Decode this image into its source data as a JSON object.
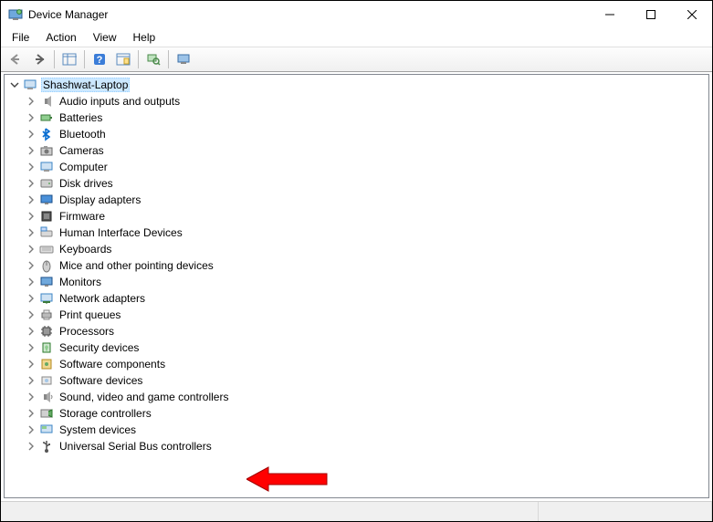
{
  "window": {
    "title": "Device Manager"
  },
  "menu": {
    "items": [
      "File",
      "Action",
      "View",
      "Help"
    ]
  },
  "tree": {
    "root": "Shashwat-Laptop",
    "children": [
      {
        "label": "Audio inputs and outputs",
        "icon": "audio"
      },
      {
        "label": "Batteries",
        "icon": "battery"
      },
      {
        "label": "Bluetooth",
        "icon": "bluetooth"
      },
      {
        "label": "Cameras",
        "icon": "camera"
      },
      {
        "label": "Computer",
        "icon": "computer"
      },
      {
        "label": "Disk drives",
        "icon": "disk"
      },
      {
        "label": "Display adapters",
        "icon": "display"
      },
      {
        "label": "Firmware",
        "icon": "firmware"
      },
      {
        "label": "Human Interface Devices",
        "icon": "hid"
      },
      {
        "label": "Keyboards",
        "icon": "keyboard"
      },
      {
        "label": "Mice and other pointing devices",
        "icon": "mouse"
      },
      {
        "label": "Monitors",
        "icon": "monitor"
      },
      {
        "label": "Network adapters",
        "icon": "network"
      },
      {
        "label": "Print queues",
        "icon": "printer"
      },
      {
        "label": "Processors",
        "icon": "cpu"
      },
      {
        "label": "Security devices",
        "icon": "security"
      },
      {
        "label": "Software components",
        "icon": "swcomp"
      },
      {
        "label": "Software devices",
        "icon": "swdev"
      },
      {
        "label": "Sound, video and game controllers",
        "icon": "sound"
      },
      {
        "label": "Storage controllers",
        "icon": "storage"
      },
      {
        "label": "System devices",
        "icon": "system"
      },
      {
        "label": "Universal Serial Bus controllers",
        "icon": "usb"
      }
    ]
  }
}
